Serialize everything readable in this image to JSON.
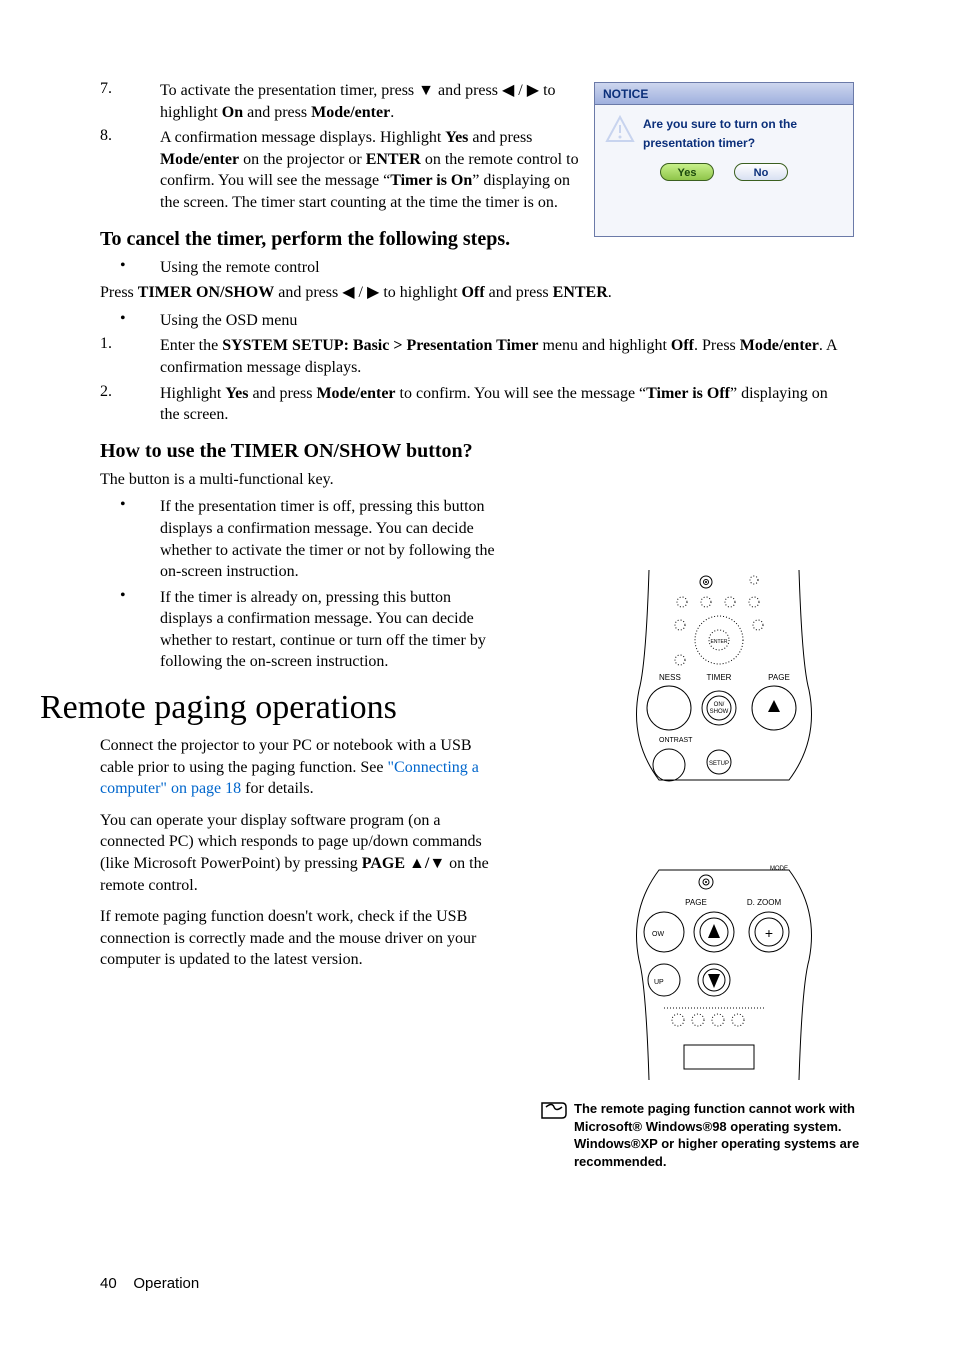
{
  "steps78": {
    "num7": "7.",
    "body7_a": "To activate the presentation timer, press ",
    "body7_down": "▼",
    "body7_b": " and press ",
    "body7_left": "◀",
    "body7_slash": " / ",
    "body7_right": "▶",
    "body7_c": " to highlight ",
    "body7_on": "On",
    "body7_d": " and press ",
    "body7_mode": "Mode/enter",
    "body7_e": ".",
    "num8": "8.",
    "body8_a": "A confirmation message displays. Highlight ",
    "body8_yes": "Yes",
    "body8_b": " and press ",
    "body8_mode": "Mode/enter",
    "body8_c": " on the projector or ",
    "body8_enter": "ENTER",
    "body8_d": " on the remote control to confirm. You will see the message “",
    "body8_timer": "Timer is On",
    "body8_e": "” displaying on the screen. The timer start counting at the time the timer is on."
  },
  "cancel_heading": "To cancel the timer, perform the following steps.",
  "cancel": {
    "bullet1": "Using the remote control",
    "press_a": "Press ",
    "press_timer": "TIMER ON/SHOW",
    "press_b": " and press ",
    "press_left": "◀",
    "press_slash": " / ",
    "press_right": "▶",
    "press_c": " to highlight ",
    "press_off": "Off",
    "press_d": " and press ",
    "press_enter": "ENTER",
    "press_e": ".",
    "bullet2": "Using the OSD menu",
    "num1": "1.",
    "body1_a": "Enter the ",
    "body1_menu": "SYSTEM SETUP: Basic > Presentation Timer",
    "body1_b": " menu and highlight ",
    "body1_off": "Off",
    "body1_c": ". Press ",
    "body1_mode": "Mode/enter",
    "body1_d": ". A confirmation message displays.",
    "num2": "2.",
    "body2_a": "Highlight ",
    "body2_yes": "Yes",
    "body2_b": " and press ",
    "body2_mode": "Mode/enter",
    "body2_c": " to confirm. You will see the message “",
    "body2_timer": "Timer is Off",
    "body2_d": "” displaying on the screen."
  },
  "howto_heading": "How to use the TIMER ON/SHOW button?",
  "howto_intro": "The button is a multi-functional key.",
  "howto_b1": "If the presentation timer is off, pressing this button displays a confirmation message. You can decide whether to activate the timer or not by following the on-screen instruction.",
  "howto_b2": "If the timer is already on, pressing this button displays a confirmation message. You can decide whether to restart, continue or turn off the timer by following the on-screen instruction.",
  "remote_heading": "Remote paging operations",
  "remote_p1_a": "Connect the projector to your PC or notebook with a USB cable prior to using the paging function. See ",
  "remote_p1_link": "\"Connecting a computer\" on page 18",
  "remote_p1_b": " for details.",
  "remote_p2_a": "You can operate your display software program (on a connected PC) which responds to page up/down commands (like Microsoft PowerPoint) by pressing ",
  "remote_p2_page": "PAGE ",
  "remote_p2_up": "▲",
  "remote_p2_slash": "/",
  "remote_p2_down": "▼",
  "remote_p2_b": " on the remote control.",
  "remote_p3": "If remote paging function doesn't work, check if the USB connection is correctly made and the mouse driver on your computer is updated to the latest version.",
  "notice": {
    "header": "NOTICE",
    "line1": "Are you sure to turn on the",
    "line2": "presentation timer?",
    "yes": "Yes",
    "no": "No"
  },
  "illus_timer": {
    "ness": "NESS",
    "timer": "TIMER",
    "page": "PAGE",
    "onshow": "ON/\nSHOW",
    "ontrast": "ONTRAST",
    "setup": "SETUP"
  },
  "illus_page": {
    "page": "PAGE",
    "dzoom": "D. ZOOM",
    "plus": "+",
    "ow": "OW",
    "up": "UP"
  },
  "note_text": "The remote paging function cannot work with Microsoft® Windows®98 operating system. Windows®XP or higher operating systems are recommended.",
  "footer_page": "40",
  "footer_section": "Operation"
}
